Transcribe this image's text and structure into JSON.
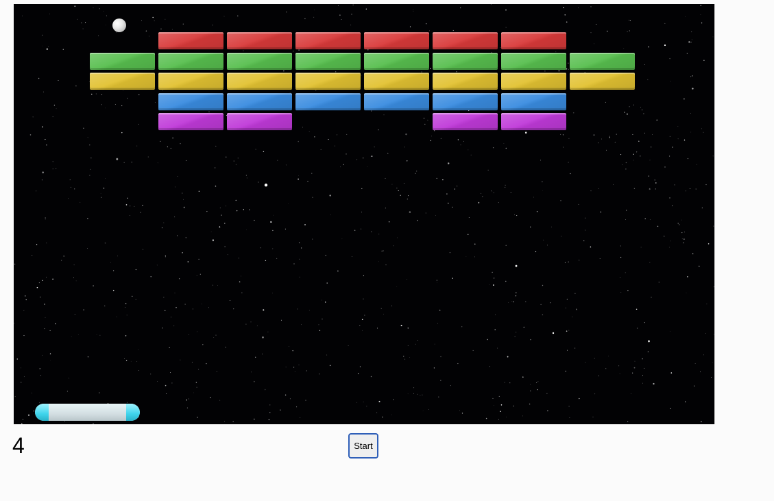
{
  "game": {
    "lives": "4",
    "start_label": "Start"
  },
  "colors": {
    "red": "#d93a3a",
    "green": "#58bf4f",
    "yellow": "#e2c232",
    "blue": "#3a8ce0",
    "purple": "#c03ad9"
  },
  "bricks": [
    {
      "row": 0,
      "color": "red",
      "columns": [
        1,
        2,
        3,
        4,
        5,
        6
      ]
    },
    {
      "row": 1,
      "color": "green",
      "columns": [
        0,
        1,
        2,
        3,
        4,
        5,
        6,
        7
      ]
    },
    {
      "row": 2,
      "color": "yellow",
      "columns": [
        0,
        1,
        2,
        3,
        4,
        5,
        6,
        7
      ]
    },
    {
      "row": 3,
      "color": "blue",
      "columns": [
        1,
        2,
        3,
        4,
        5,
        6
      ]
    },
    {
      "row": 4,
      "color": "purple",
      "columns": [
        1,
        2,
        5,
        6
      ]
    }
  ]
}
